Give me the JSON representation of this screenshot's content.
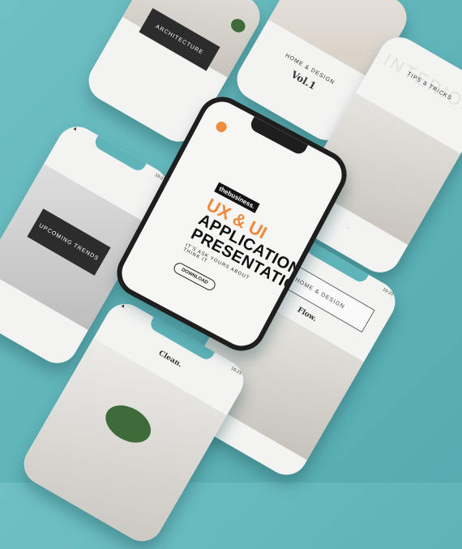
{
  "center_phone": {
    "brand": "thebusiness.",
    "line1": "UX & UI",
    "line2": "APPLICATION",
    "line3": "PRESENTATION",
    "tagline": "IT'S ASK YOURS ABOUT THINK IT",
    "button": "DOWNLOAD"
  },
  "cards": {
    "architecture": "ARCHITECTURE",
    "home_design_vol": "HOME & DESIGN",
    "vol_title": "Vol.1",
    "tips": "TIPS & TRICKS",
    "interior_watermark": "INTERIOR",
    "upcoming": "UPCOMING TRENDS",
    "home_design_2": "HOME & DESIGN",
    "flow": "Flow.",
    "clean": "Clean."
  },
  "status": {
    "time": "10:25"
  },
  "colors": {
    "background": "#5fb4b9",
    "accent": "#f08a3c",
    "dark": "#2c2c2c"
  }
}
